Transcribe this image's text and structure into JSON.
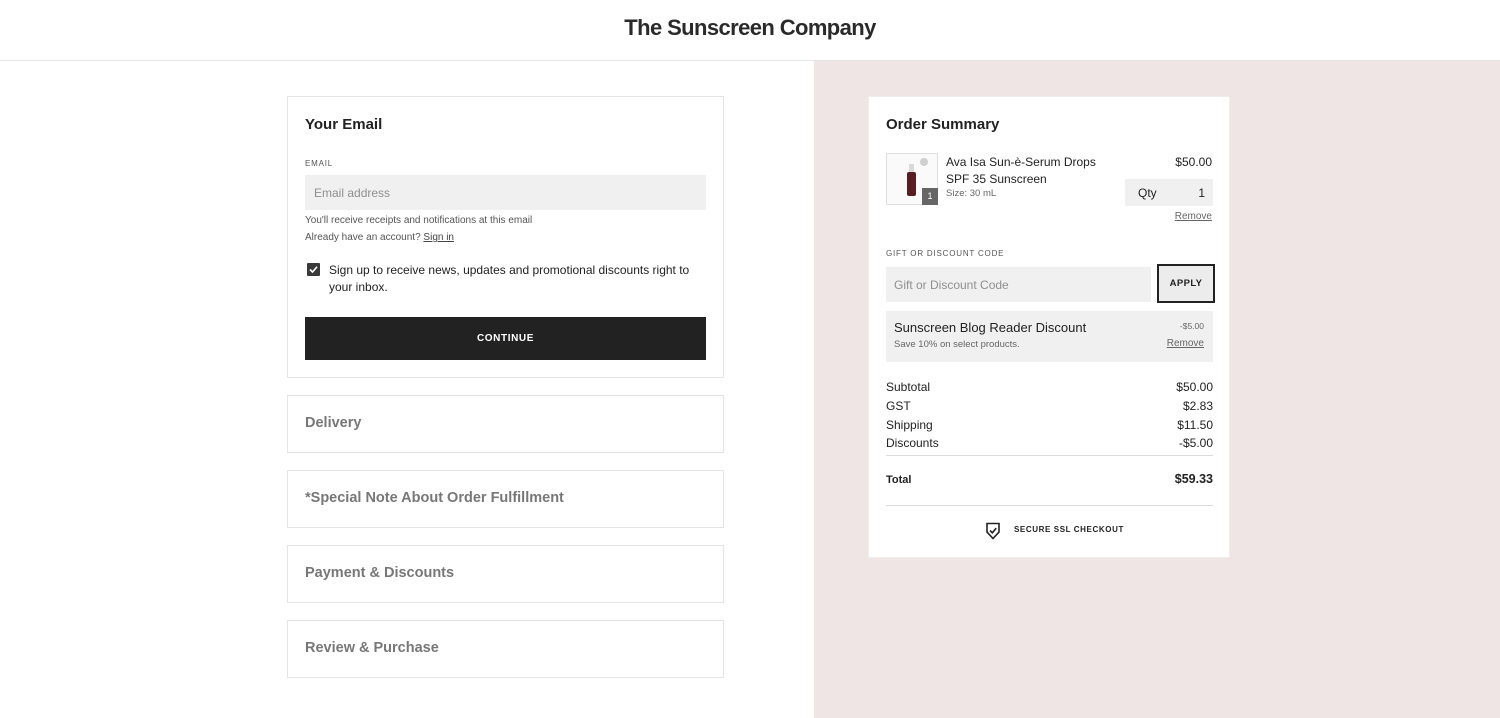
{
  "header": {
    "brand": "The Sunscreen Company"
  },
  "email_section": {
    "title": "Your Email",
    "email_label": "EMAIL",
    "email_placeholder": "Email address",
    "email_value": "",
    "helper_receipts": "You'll receive receipts and notifications at this email",
    "helper_account": "Already have an account?",
    "sign_in_link": "Sign in",
    "newsletter_checked": true,
    "newsletter_label": "Sign up to receive news, updates and promotional discounts right to your inbox.",
    "continue_label": "CONTINUE"
  },
  "steps": [
    {
      "label": "Delivery"
    },
    {
      "label": "*Special Note About Order Fulfillment"
    },
    {
      "label": "Payment & Discounts"
    },
    {
      "label": "Review & Purchase"
    }
  ],
  "order_summary": {
    "title": "Order Summary",
    "item": {
      "name": "Ava Isa Sun-è-Serum Drops SPF 35 Sunscreen",
      "size": "Size: 30 mL",
      "price": "$50.00",
      "quantity_badge": "1",
      "qty_label": "Qty",
      "qty_value": "1",
      "remove_label": "Remove"
    },
    "code_label": "GIFT OR DISCOUNT CODE",
    "code_placeholder": "Gift or Discount Code",
    "apply_label": "APPLY",
    "applied_discount": {
      "name": "Sunscreen Blog Reader Discount",
      "description": "Save 10% on select products.",
      "amount": "-$5.00",
      "remove_label": "Remove"
    },
    "totals": {
      "subtotal_label": "Subtotal",
      "subtotal": "$50.00",
      "gst_label": "GST",
      "gst": "$2.83",
      "shipping_label": "Shipping",
      "shipping": "$11.50",
      "discounts_label": "Discounts",
      "discounts": "-$5.00",
      "total_label": "Total",
      "total": "$59.33"
    },
    "secure_label": "SECURE SSL CHECKOUT",
    "secure_icon": "shield-check-icon"
  },
  "colors": {
    "primary_button": "#222222",
    "summary_background": "#efe5e5",
    "input_background": "#f0f0f0"
  }
}
